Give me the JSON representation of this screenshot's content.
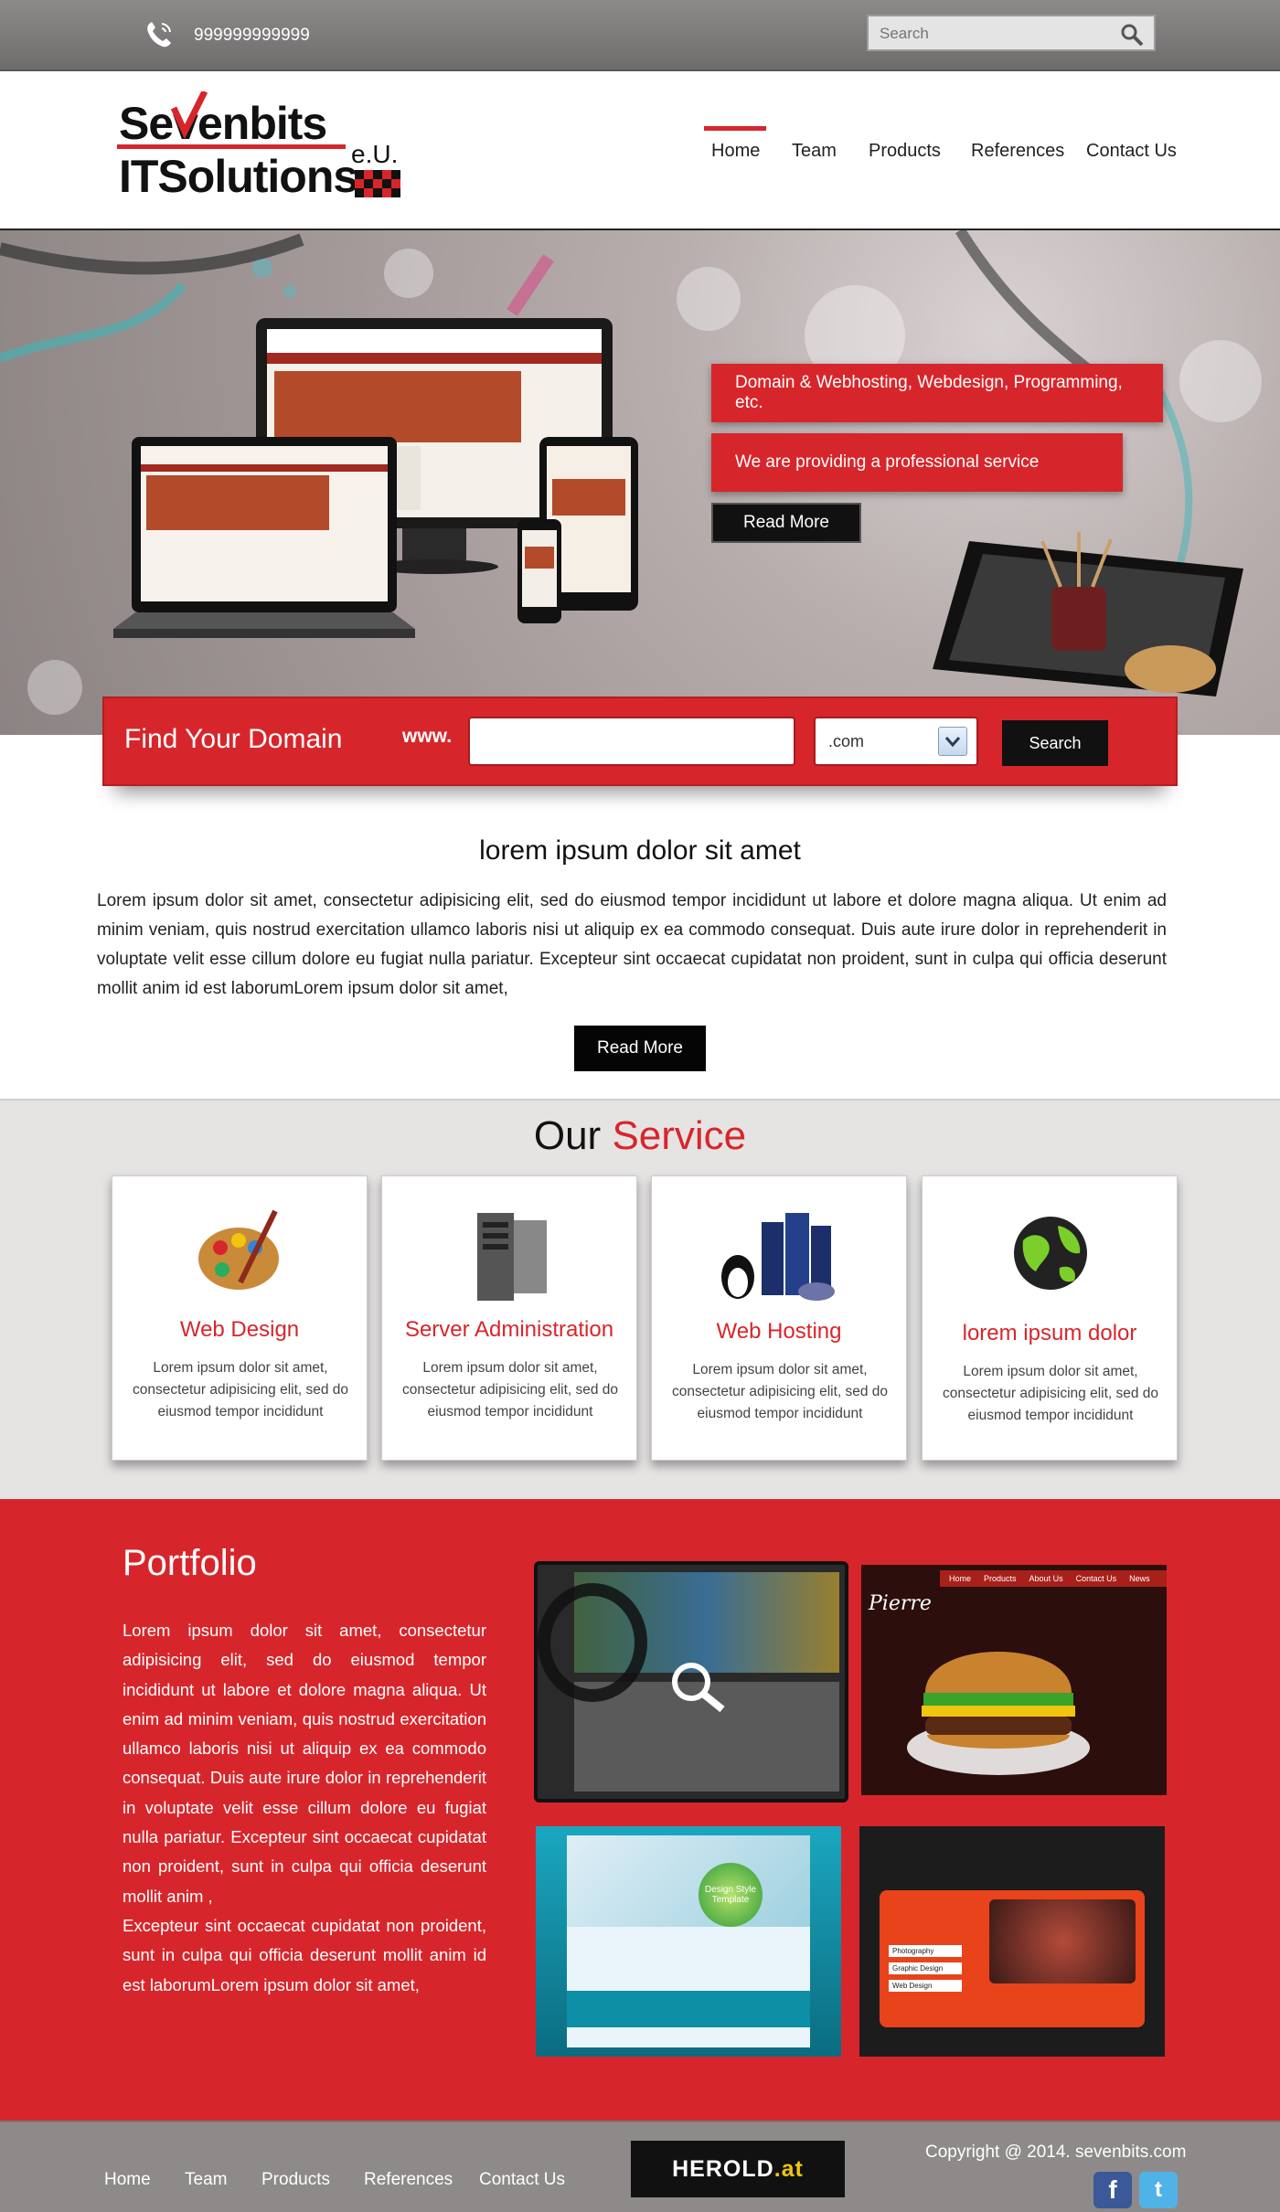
{
  "topbar": {
    "phone": "999999999999",
    "search_placeholder": "Search"
  },
  "logo": {
    "line1": "Sevenbits",
    "line2": "ITSolutions",
    "suffix": "e.U."
  },
  "nav": {
    "items": [
      "Home",
      "Team",
      "Products",
      "References",
      "Contact Us"
    ],
    "active": "Home"
  },
  "hero": {
    "tag1": "Domain & Webhosting, Webdesign, Programming, etc.",
    "tag2": "We are providing  a professional service",
    "read_more": "Read More"
  },
  "domain": {
    "title": "Find Your Domain",
    "www": "www.",
    "tld": ".com",
    "search_label": "Search"
  },
  "intro": {
    "title": "lorem ipsum dolor sit amet",
    "text": "Lorem ipsum dolor sit amet, consectetur adipisicing elit, sed do eiusmod tempor incididunt ut labore et dolore magna aliqua. Ut enim ad minim veniam, quis nostrud exercitation ullamco laboris nisi ut aliquip ex ea commodo consequat. Duis aute irure dolor in reprehenderit in voluptate velit esse cillum dolore eu fugiat nulla pariatur. Excepteur sint occaecat cupidatat non proident, sunt in culpa qui officia deserunt mollit anim id est laborumLorem ipsum dolor sit amet,",
    "read_more": "Read More"
  },
  "service": {
    "title_a": "Our",
    "title_b": "Service",
    "cards": [
      {
        "title": "Web Design",
        "text": "Lorem ipsum dolor sit amet, consectetur adipisicing elit, sed do eiusmod tempor incididunt",
        "icon": "palette-icon"
      },
      {
        "title": "Server Administration",
        "text": "Lorem ipsum dolor sit amet, consectetur adipisicing elit, sed do eiusmod tempor incididunt",
        "icon": "server-icon"
      },
      {
        "title": "Web Hosting",
        "text": "Lorem ipsum dolor sit amet, consectetur adipisicing elit, sed do eiusmod tempor incididunt",
        "icon": "hosting-icon"
      },
      {
        "title": "lorem ipsum dolor",
        "text": "Lorem ipsum dolor sit amet, consectetur adipisicing elit, sed do eiusmod tempor incididunt",
        "icon": "globe-icon"
      }
    ]
  },
  "portfolio": {
    "title": "Portfolio",
    "text": "Lorem ipsum dolor sit amet, consectetur adipisicing elit, sed do eiusmod tempor incididunt ut labore et dolore magna aliqua. Ut enim ad minim veniam, quis nostrud exercitation ullamco laboris nisi ut aliquip ex ea commodo consequat. Duis aute irure dolor in reprehenderit in voluptate velit esse cillum dolore eu fugiat nulla pariatur. Excepteur sint occaecat cupidatat non proident, sunt in culpa qui officia deserunt mollit anim ,\n Excepteur sint occaecat cupidatat non proident, sunt in culpa qui officia deserunt mollit anim id est laborumLorem ipsum dolor sit amet,",
    "thumb2_brand": "Pierre",
    "thumb2_nav": [
      "Home",
      "Products",
      "About Us",
      "Contact Us",
      "News"
    ],
    "thumb3_label": "Design Style Template",
    "thumb4_items": [
      "Photography",
      "Graphic Design",
      "Web Design"
    ]
  },
  "footer": {
    "links": [
      "Home",
      "Team",
      "Products",
      "References",
      "Contact Us"
    ],
    "herold_a": "HEROLD",
    "herold_b": ".at",
    "copyright": "Copyright @ 2014. sevenbits.com",
    "social": [
      "f",
      "t"
    ]
  },
  "colors": {
    "accent": "#d7262b",
    "dark": "#111111",
    "footer": "#8e8a8a",
    "service_bg": "#e6e3e3"
  }
}
